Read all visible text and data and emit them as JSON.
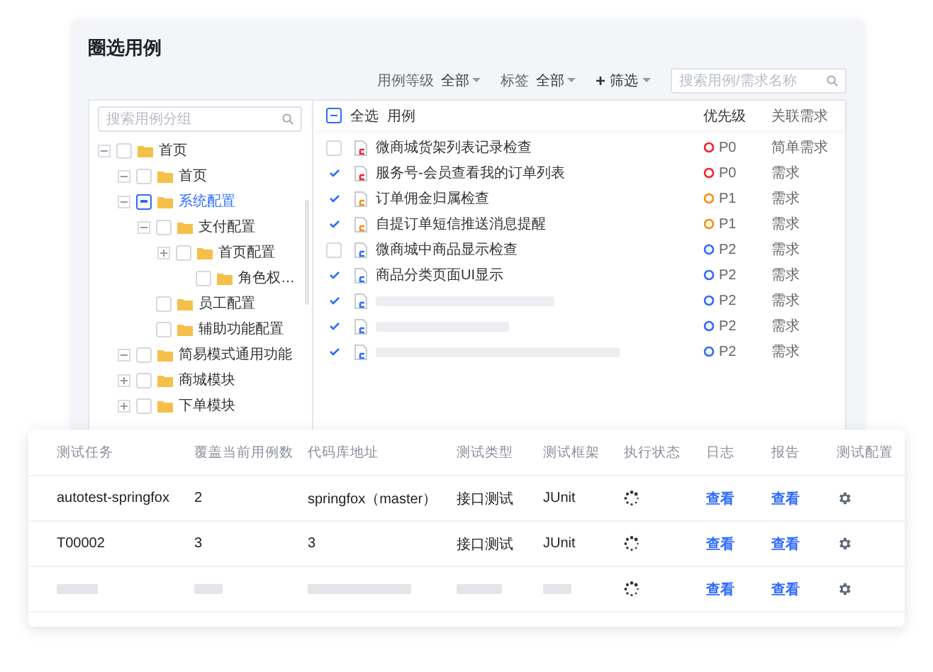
{
  "title": "圈选用例",
  "filters": [
    {
      "label": "用例等级",
      "value": "全部"
    },
    {
      "label": "标签",
      "value": "全部"
    }
  ],
  "filter_button": {
    "icon": "+",
    "label": "筛选"
  },
  "search": {
    "placeholder": "搜索用例/需求名称"
  },
  "tree": {
    "search": {
      "placeholder": "搜索用例分组"
    },
    "items": [
      {
        "label": "首页",
        "checked": false,
        "indeterminate": false,
        "expanded": true,
        "children": [
          {
            "label": "首页",
            "checked": false,
            "indeterminate": false,
            "expanded": true
          },
          {
            "label": "系统配置",
            "checked": false,
            "indeterminate": true,
            "expanded": true,
            "children": [
              {
                "label": "支付配置",
                "checked": false,
                "indeterminate": false,
                "expanded": true,
                "children": [
                  {
                    "label": "首页配置",
                    "checked": false,
                    "indeterminate": false,
                    "expanded": false,
                    "children": [
                      {
                        "label": "角色权…",
                        "checked": false,
                        "indeterminate": false
                      }
                    ]
                  }
                ]
              },
              {
                "label": "员工配置",
                "checked": false,
                "indeterminate": false
              },
              {
                "label": "辅助功能配置",
                "checked": false,
                "indeterminate": false
              }
            ]
          },
          {
            "label": "简易模式通用功能",
            "checked": false,
            "indeterminate": false,
            "expanded": true
          },
          {
            "label": "商城模块",
            "checked": false,
            "indeterminate": false,
            "expanded": false
          },
          {
            "label": "下单模块",
            "checked": false,
            "indeterminate": false,
            "expanded": false
          }
        ]
      }
    ]
  },
  "cases": {
    "select_all": {
      "label": "全选",
      "checked": false,
      "indeterminate": true
    },
    "columns": [
      "用例",
      "优先级",
      "关联需求"
    ],
    "rows": [
      {
        "kind": "text",
        "name": "微商城货架列表记录检查",
        "priority": "P0",
        "color": "#f5222d",
        "requirement": "简单需求",
        "checked": false
      },
      {
        "kind": "text",
        "name": "服务号-会员查看我的订单列表",
        "priority": "P0",
        "color": "#f5222d",
        "requirement": "需求",
        "checked": true
      },
      {
        "kind": "text",
        "name": "订单佣金归属检查",
        "priority": "P1",
        "color": "#fa8c16",
        "requirement": "需求",
        "checked": true
      },
      {
        "kind": "text",
        "name": "自提订单短信推送消息提醒",
        "priority": "P1",
        "color": "#fa8c16",
        "requirement": "需求",
        "checked": true
      },
      {
        "kind": "text",
        "name": "微商城中商品显示检查",
        "priority": "P2",
        "color": "#2f6bff",
        "requirement": "需求",
        "checked": false
      },
      {
        "kind": "text",
        "name": "商品分类页面UI显示",
        "priority": "P2",
        "color": "#2f6bff",
        "requirement": "需求",
        "checked": true
      },
      {
        "kind": "skeleton",
        "priority": "P2",
        "color": "#2f6bff",
        "requirement": "需求",
        "checked": true
      },
      {
        "kind": "skeleton",
        "priority": "P2",
        "color": "#2f6bff",
        "requirement": "需求",
        "checked": true
      },
      {
        "kind": "skeleton",
        "priority": "P2",
        "color": "#2f6bff",
        "requirement": "需求",
        "checked": true
      }
    ]
  },
  "tasks": {
    "columns": [
      "测试任务",
      "覆盖当前用例数",
      "代码库地址",
      "测试类型",
      "测试框架",
      "执行状态",
      "日志",
      "报告",
      "测试配置"
    ],
    "rows": [
      {
        "kind": "text",
        "task": "autotest-springfox",
        "count": "2",
        "repo": "springfox（master）",
        "type": "接口测试",
        "framework": "JUnit",
        "log": "查看",
        "report": "查看"
      },
      {
        "kind": "text",
        "task": "T00002",
        "count": "3",
        "repo": "3",
        "type": "接口测试",
        "framework": "JUnit",
        "log": "查看",
        "report": "查看"
      },
      {
        "kind": "skeleton",
        "log": "查看",
        "report": "查看"
      }
    ]
  }
}
